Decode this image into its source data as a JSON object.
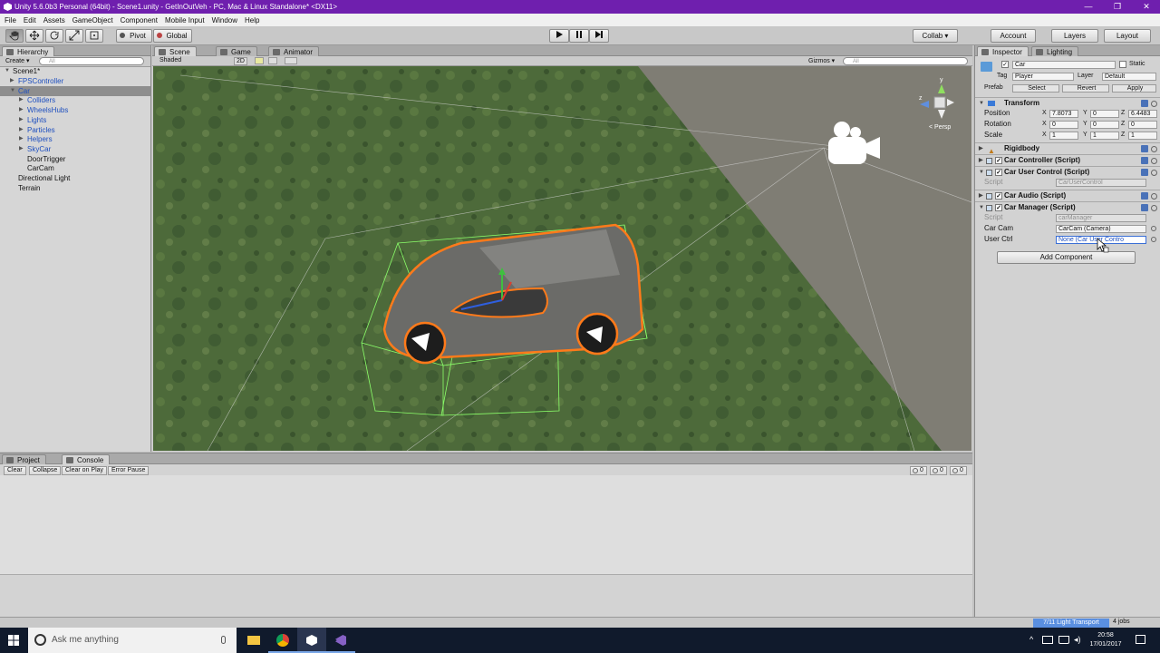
{
  "window": {
    "title": "Unity 5.6.0b3 Personal (64bit) - Scene1.unity - GetInOutVeh - PC, Mac & Linux Standalone* <DX11>"
  },
  "menu": [
    "File",
    "Edit",
    "Assets",
    "GameObject",
    "Component",
    "Mobile Input",
    "Window",
    "Help"
  ],
  "toolbar": {
    "pivot": "Pivot",
    "global": "Global",
    "collab": "Collab ▾",
    "account": "Account",
    "layers": "Layers",
    "layout": "Layout"
  },
  "hierarchy": {
    "tab": "Hierarchy",
    "create": "Create ▾",
    "search": "All",
    "scene": "Scene1*",
    "items": [
      {
        "label": "FPSController",
        "blue": true,
        "indent": 1,
        "arrow": true
      },
      {
        "label": "Car",
        "blue": true,
        "indent": 1,
        "arrow": true,
        "expanded": true,
        "selected": true
      },
      {
        "label": "Colliders",
        "blue": true,
        "indent": 2,
        "arrow": true
      },
      {
        "label": "WheelsHubs",
        "blue": true,
        "indent": 2,
        "arrow": true
      },
      {
        "label": "Lights",
        "blue": true,
        "indent": 2,
        "arrow": true
      },
      {
        "label": "Particles",
        "blue": true,
        "indent": 2,
        "arrow": true
      },
      {
        "label": "Helpers",
        "blue": true,
        "indent": 2,
        "arrow": true
      },
      {
        "label": "SkyCar",
        "blue": true,
        "indent": 2,
        "arrow": true
      },
      {
        "label": "DoorTrigger",
        "blue": false,
        "indent": 2,
        "arrow": false
      },
      {
        "label": "CarCam",
        "blue": false,
        "indent": 2,
        "arrow": false
      },
      {
        "label": "Directional Light",
        "blue": false,
        "indent": 1,
        "arrow": false
      },
      {
        "label": "Terrain",
        "blue": false,
        "indent": 1,
        "arrow": false
      }
    ]
  },
  "scene": {
    "tabs": [
      "Scene",
      "Game",
      "Animator"
    ],
    "shading": "Shaded",
    "mode2d": "2D",
    "gizmos": "Gizmos ▾",
    "search": "All",
    "persp": "< Persp"
  },
  "inspector": {
    "tabs": [
      "Inspector",
      "Lighting"
    ],
    "name": "Car",
    "static": "Static",
    "tag_label": "Tag",
    "tag": "Player",
    "layer_label": "Layer",
    "layer": "Default",
    "prefab_label": "Prefab",
    "prefab_buttons": [
      "Select",
      "Revert",
      "Apply"
    ],
    "transform": {
      "title": "Transform",
      "rows": [
        {
          "label": "Position",
          "x": "7.8073",
          "y": "0",
          "z": "6.4483"
        },
        {
          "label": "Rotation",
          "x": "0",
          "y": "0",
          "z": "0"
        },
        {
          "label": "Scale",
          "x": "1",
          "y": "1",
          "z": "1"
        }
      ]
    },
    "components": {
      "rigidbody": "Rigidbody",
      "car_controller": "Car Controller (Script)",
      "car_user_control": "Car User Control (Script)",
      "car_user_control_script_label": "Script",
      "car_user_control_script": "CarUserControl",
      "car_audio": "Car Audio (Script)",
      "car_manager": "Car Manager (Script)",
      "car_manager_script_label": "Script",
      "car_manager_script": "carManager",
      "car_cam_label": "Car Cam",
      "car_cam": "CarCam (Camera)",
      "user_ctrl_label": "User Ctrl",
      "user_ctrl": "None (Car User Contro"
    },
    "add_component": "Add Component"
  },
  "console": {
    "tabs": [
      "Project",
      "Console"
    ],
    "buttons": [
      "Clear",
      "Collapse",
      "Clear on Play",
      "Error Pause"
    ],
    "counts": [
      "0",
      "0",
      "0"
    ]
  },
  "status": {
    "light": "7/11 Light Transport",
    "jobs": "4 jobs"
  },
  "taskbar": {
    "search": "Ask me anything",
    "time": "20:58",
    "date": "17/01/2017"
  },
  "colors": {
    "title_bar": "#6f1fae",
    "taskbar": "#101a2c",
    "selection": "#8e8e8e",
    "highlight_outline": "#ff7a1a"
  }
}
